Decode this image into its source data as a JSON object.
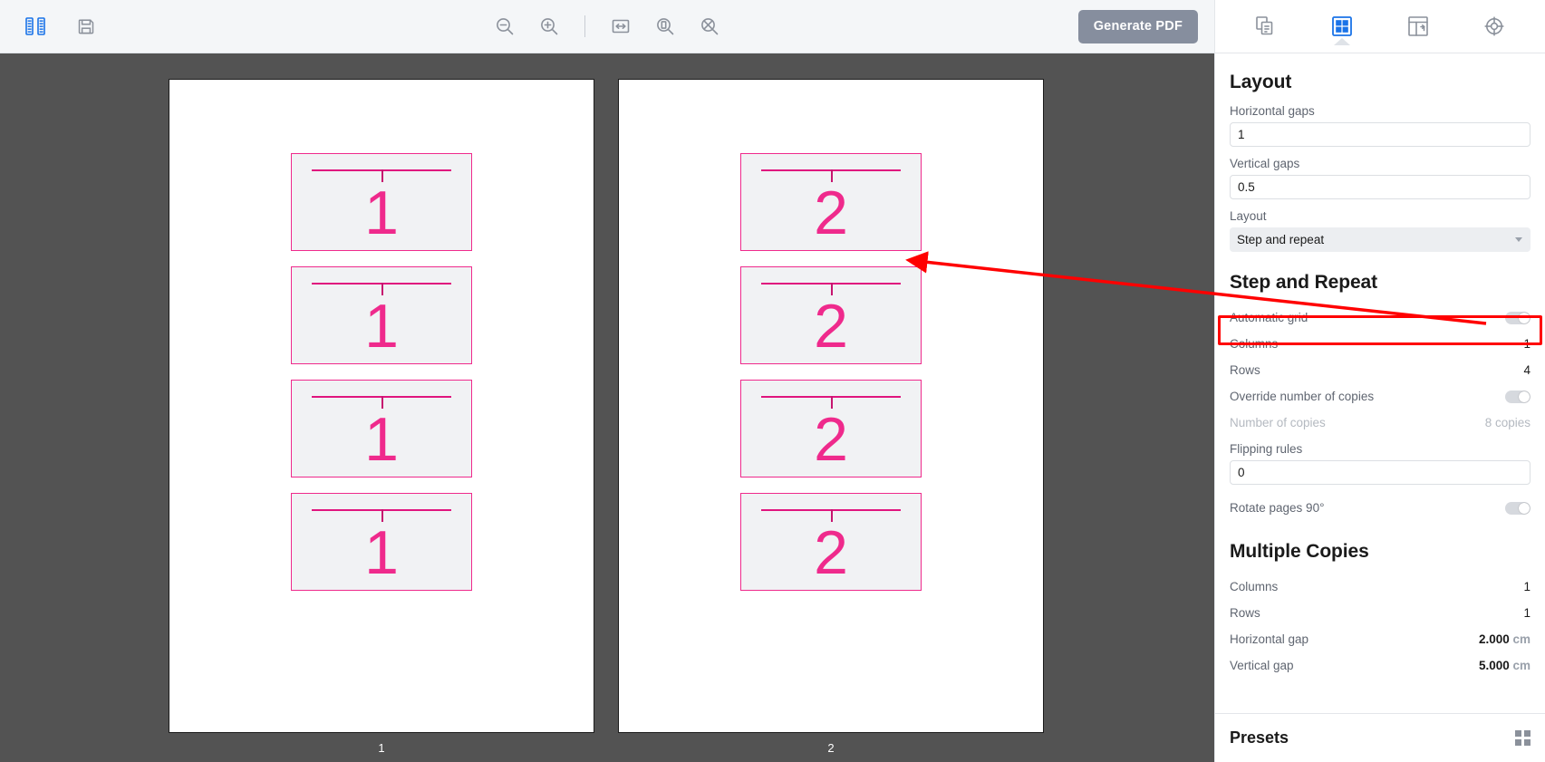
{
  "toolbar": {
    "left_icons": [
      {
        "name": "toggle-side-panel-icon",
        "state": "active"
      },
      {
        "name": "save-icon",
        "state": "default"
      }
    ],
    "center_icons": [
      {
        "name": "zoom-out-icon"
      },
      {
        "name": "zoom-in-icon"
      },
      {
        "name": "fit-width-icon"
      },
      {
        "name": "fit-page-icon"
      },
      {
        "name": "zoom-reset-icon"
      }
    ],
    "generate_pdf_label": "Generate PDF"
  },
  "panel": {
    "tabs": [
      {
        "name": "tab-copies",
        "icon": "copy-pages-icon",
        "active": false
      },
      {
        "name": "tab-layout",
        "icon": "grid-layout-icon",
        "active": true
      },
      {
        "name": "tab-marks",
        "icon": "page-marks-icon",
        "active": false
      },
      {
        "name": "tab-registration",
        "icon": "registration-target-icon",
        "active": false
      }
    ],
    "layout": {
      "title": "Layout",
      "horizontal_gaps_label": "Horizontal gaps",
      "horizontal_gaps_value": "1",
      "vertical_gaps_label": "Vertical gaps",
      "vertical_gaps_value": "0.5",
      "layout_label": "Layout",
      "layout_value": "Step and repeat"
    },
    "step_and_repeat": {
      "title": "Step and Repeat",
      "rows": [
        {
          "label": "Automatic grid",
          "type": "toggle",
          "value": "off"
        },
        {
          "label": "Columns",
          "type": "number",
          "value": "1",
          "highlighted": true
        },
        {
          "label": "Rows",
          "type": "number",
          "value": "4"
        },
        {
          "label": "Override number of copies",
          "type": "toggle",
          "value": "off"
        },
        {
          "label": "Number of copies",
          "type": "number",
          "value": "8 copies",
          "disabled": true
        }
      ],
      "flipping_rules_label": "Flipping rules",
      "flipping_rules_value": "0",
      "rotate_label": "Rotate pages 90°",
      "rotate_value": "off"
    },
    "multiple_copies": {
      "title": "Multiple Copies",
      "rows": [
        {
          "label": "Columns",
          "value": "1",
          "unit": ""
        },
        {
          "label": "Rows",
          "value": "1",
          "unit": ""
        },
        {
          "label": "Horizontal gap",
          "value": "2.000",
          "unit": "cm"
        },
        {
          "label": "Vertical gap",
          "value": "5.000",
          "unit": "cm"
        }
      ]
    },
    "presets": {
      "title": "Presets",
      "icon": "preset-grid-icon"
    }
  },
  "canvas": {
    "pages": [
      {
        "label": "1",
        "artworks": [
          {
            "number": "1"
          },
          {
            "number": "1"
          },
          {
            "number": "1"
          },
          {
            "number": "1"
          }
        ]
      },
      {
        "label": "2",
        "artworks": [
          {
            "number": "2"
          },
          {
            "number": "2"
          },
          {
            "number": "2"
          },
          {
            "number": "2"
          }
        ]
      }
    ]
  },
  "annotations": {
    "highlight_color": "#ff0000",
    "arrow_target": "Columns row in Step and Repeat"
  }
}
